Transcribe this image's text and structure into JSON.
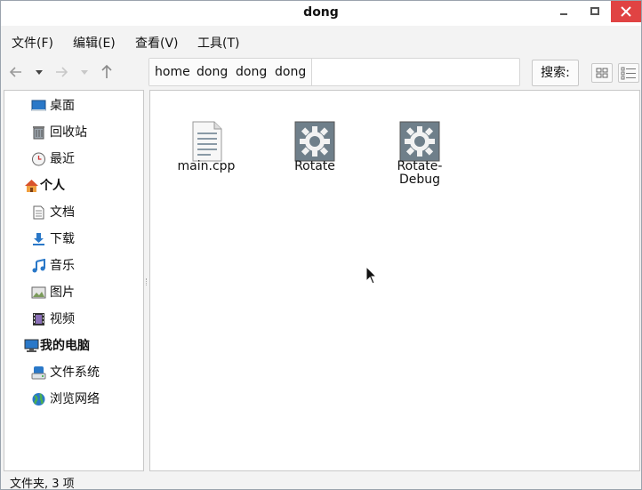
{
  "window": {
    "title": "dong"
  },
  "menu": {
    "items": [
      {
        "label": "文件(F)"
      },
      {
        "label": "编辑(E)"
      },
      {
        "label": "查看(V)"
      },
      {
        "label": "工具(T)"
      }
    ]
  },
  "toolbar": {
    "breadcrumbs": [
      "home",
      "dong",
      "dong",
      "dong"
    ],
    "search_label": "搜索:"
  },
  "sidebar": {
    "places": [
      {
        "label": "桌面",
        "icon": "desktop-icon"
      },
      {
        "label": "回收站",
        "icon": "trash-icon"
      },
      {
        "label": "最近",
        "icon": "recent-clock-icon"
      }
    ],
    "personal_group": "个人",
    "personal": [
      {
        "label": "文档",
        "icon": "document-icon"
      },
      {
        "label": "下载",
        "icon": "download-icon"
      },
      {
        "label": "音乐",
        "icon": "music-icon"
      },
      {
        "label": "图片",
        "icon": "picture-icon"
      },
      {
        "label": "视频",
        "icon": "video-icon"
      }
    ],
    "computer_group": "我的电脑",
    "computer": [
      {
        "label": "文件系统",
        "icon": "drive-icon"
      },
      {
        "label": "浏览网络",
        "icon": "network-globe-icon"
      }
    ]
  },
  "files": [
    {
      "name": "main.cpp",
      "icon": "text-file-icon"
    },
    {
      "name": "Rotate",
      "icon": "executable-gear-icon"
    },
    {
      "name": "Rotate-Debug",
      "icon": "executable-gear-icon"
    }
  ],
  "status": {
    "text": "文件夹, 3 项"
  },
  "colors": {
    "close_button": "#e04343",
    "gear_tile": "#6f7f8a",
    "folder_blue": "#2a78c8"
  }
}
